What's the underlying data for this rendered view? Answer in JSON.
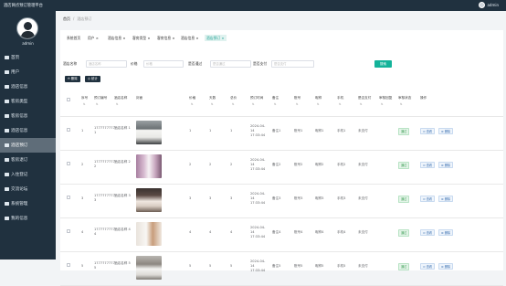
{
  "topbar": {
    "title": "酒店网点预订管理平台",
    "user_name": "admin"
  },
  "sidebar": {
    "user_name": "admin",
    "items": [
      {
        "label": "首页",
        "icon": "home-icon",
        "active": false
      },
      {
        "label": "用户",
        "icon": "user-icon",
        "active": false
      },
      {
        "label": "酒店信息",
        "icon": "hotel-icon",
        "active": false
      },
      {
        "label": "客房类型",
        "icon": "room-type-icon",
        "active": false
      },
      {
        "label": "客房信息",
        "icon": "room-icon",
        "active": false
      },
      {
        "label": "酒店信息",
        "icon": "info-icon",
        "active": false
      },
      {
        "label": "酒店预订",
        "icon": "booking-icon",
        "active": true
      },
      {
        "label": "客房退订",
        "icon": "cancel-icon",
        "active": false
      },
      {
        "label": "入住登记",
        "icon": "checkin-icon",
        "active": false
      },
      {
        "label": "交流论坛",
        "icon": "forum-icon",
        "active": false
      },
      {
        "label": "系统管理",
        "icon": "settings-icon",
        "active": false
      },
      {
        "label": "我的信息",
        "icon": "profile-icon",
        "active": false
      }
    ]
  },
  "breadcrumb": {
    "home": "首页",
    "separator": "/",
    "current": "酒店预订"
  },
  "tabs": [
    {
      "label": "系统首页",
      "active": false
    },
    {
      "label": "用户 ×",
      "active": false
    },
    {
      "label": "酒店信息 ×",
      "active": false
    },
    {
      "label": "客房类型 ×",
      "active": false
    },
    {
      "label": "客房信息 ×",
      "active": false
    },
    {
      "label": "酒店信息 ×",
      "active": false
    },
    {
      "label": "酒店预订 ×",
      "active": true
    }
  ],
  "filters": [
    {
      "label": "酒店名称",
      "placeholder": "酒店名称"
    },
    {
      "label": "价格",
      "placeholder": "价格"
    },
    {
      "label": "是否通过",
      "placeholder": "是否通过"
    },
    {
      "label": "是否支付",
      "placeholder": "是否支付"
    }
  ],
  "search_button": "搜索",
  "actions": {
    "delete": "删除",
    "stats": "统计"
  },
  "columns": [
    "",
    "序号",
    "预订编号",
    "酒店名称",
    "封面",
    "价格",
    "天数",
    "总价",
    "预订时间",
    "备注",
    "账号",
    "昵称",
    "手机",
    "是否支付",
    "审核回复",
    "审核状态",
    "操作"
  ],
  "sort_glyph": "⇅",
  "row_buttons": {
    "view": "查看",
    "delete": "删除"
  },
  "rows": [
    {
      "no": "1",
      "code": "1777777777 1",
      "hotel": "酒店名称 1",
      "price": "1",
      "days": "1",
      "total": "1",
      "time": "2024-04-14 17:33:44",
      "remark": "备注1",
      "account": "账号1",
      "nickname": "昵称1",
      "phone": "手机1",
      "paid": "未支付",
      "reply": "",
      "status": "通过"
    },
    {
      "no": "2",
      "code": "1777777777 2",
      "hotel": "酒店名称 2",
      "price": "2",
      "days": "2",
      "total": "2",
      "time": "2024-04-14 17:33:44",
      "remark": "备注2",
      "account": "账号2",
      "nickname": "昵称2",
      "phone": "手机2",
      "paid": "未支付",
      "reply": "",
      "status": "通过"
    },
    {
      "no": "3",
      "code": "1777777777 3",
      "hotel": "酒店名称 3",
      "price": "3",
      "days": "3",
      "total": "3",
      "time": "2024-04-14 17:33:44",
      "remark": "备注3",
      "account": "账号3",
      "nickname": "昵称3",
      "phone": "手机3",
      "paid": "未支付",
      "reply": "",
      "status": "通过"
    },
    {
      "no": "4",
      "code": "1777777777 4",
      "hotel": "酒店名称 4",
      "price": "4",
      "days": "4",
      "total": "4",
      "time": "2024-04-14 17:33:44",
      "remark": "备注4",
      "account": "账号4",
      "nickname": "昵称4",
      "phone": "手机4",
      "paid": "未支付",
      "reply": "",
      "status": "通过"
    },
    {
      "no": "5",
      "code": "1777777777 5",
      "hotel": "酒店名称 5",
      "price": "5",
      "days": "5",
      "total": "5",
      "time": "2024-04-14 17:33:44",
      "remark": "备注5",
      "account": "账号5",
      "nickname": "昵称5",
      "phone": "手机5",
      "paid": "未支付",
      "reply": "",
      "status": "通过"
    }
  ],
  "colors": {
    "sidebar": "#20313f",
    "active_menu": "#5f6d79",
    "accent": "#14b39a",
    "tag_green": "#3a9b52"
  }
}
